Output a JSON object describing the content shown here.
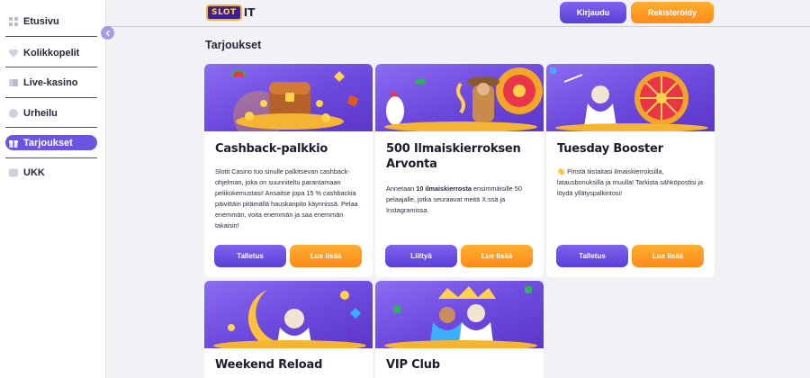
{
  "sidebar": {
    "items": [
      {
        "label": "Etusivu",
        "icon": "home-icon"
      },
      {
        "label": "Kolikkopelit",
        "icon": "heart-icon"
      },
      {
        "label": "Live-kasino",
        "icon": "cards-icon"
      },
      {
        "label": "Urheilu",
        "icon": "ball-icon"
      },
      {
        "label": "Tarjoukset",
        "icon": "gift-icon",
        "active": true
      },
      {
        "label": "UKK",
        "icon": "help-icon"
      }
    ]
  },
  "header": {
    "logo_slot": "SLOT",
    "logo_it": "IT",
    "login_label": "Kirjaudu",
    "register_label": "Rekisteröidy"
  },
  "main": {
    "section_title": "Tarjoukset",
    "cards": [
      {
        "title": "Cashback-palkkio",
        "body": "Slotit Casino tuo sinulle palkitsevan cashback-ohjelman, joka on suunniteltu parantamaan pelikokemustasi! Ansaitse jopa 15 % cashbackia päivittäin pitämällä hauskanpito käynnissä. Pelaa enemmän, voita enemmän ja saa enemmän takaisin!",
        "primary_label": "Talletus",
        "secondary_label": "Lue lisää"
      },
      {
        "title": "500 Ilmaiskierroksen Arvonta",
        "body_pre": "Annetaan ",
        "body_bold": "10 ilmaiskierrosta",
        "body_post": " ensimmäisille 50 pelaajalle, jotka seuraavat meitä X:ssä ja Instagramissa.",
        "primary_label": "Liittyä",
        "secondary_label": "Lue lisää"
      },
      {
        "title": "Tuesday Booster",
        "body": "👋 Piristä tiistaitasi ilmaiskierroksilla, latausbonuksilla ja muulla! Tarkista sähköpostisi ja löydä yllätyspalkintosi!",
        "primary_label": "Talletus",
        "secondary_label": "Lue lisää"
      },
      {
        "title": "Weekend Reload"
      },
      {
        "title": "VIP Club"
      }
    ]
  },
  "colors": {
    "purple": "#6b55e0",
    "orange": "#ff9a22",
    "background": "#f2f1f6"
  }
}
